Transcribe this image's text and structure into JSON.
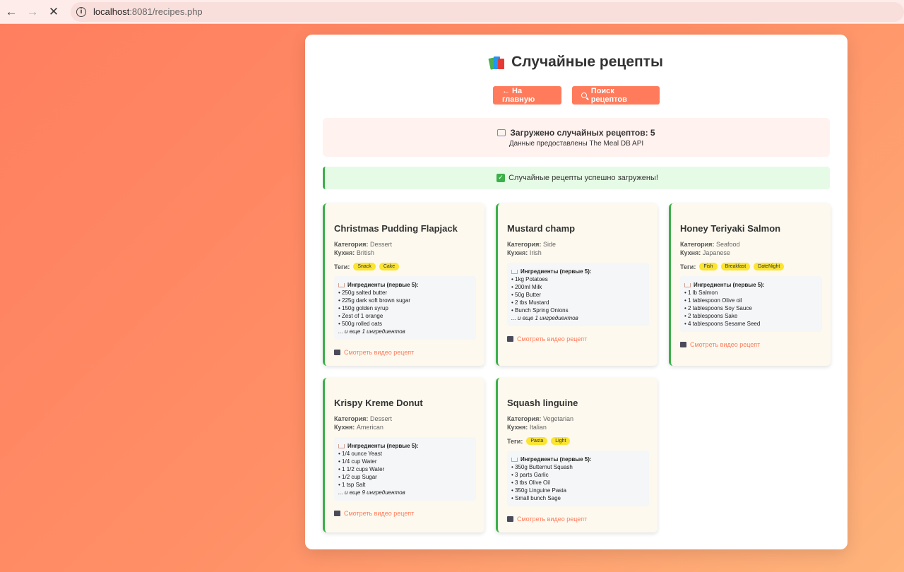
{
  "browser": {
    "url_host": "localhost",
    "url_path": ":8081/recipes.php"
  },
  "page": {
    "title": "Случайные рецепты",
    "home_button": "← На главную",
    "search_button": "Поиск рецептов",
    "info_main": "Загружено случайных рецептов: 5",
    "info_sub": "Данные предоставлены The Meal DB API",
    "success_message": "Случайные рецепты успешно загружены!"
  },
  "labels": {
    "category": "Категория:",
    "cuisine": "Кухня:",
    "tags": "Теги:",
    "ingredients_head": "Ингредиенты (первые 5):",
    "video_link": "Смотреть видео рецепт"
  },
  "recipes": [
    {
      "name": "Christmas Pudding Flapjack",
      "category": "Dessert",
      "cuisine": "British",
      "tags": [
        "Snack",
        "Cake"
      ],
      "ingredients": [
        "250g salted butter",
        "225g dark soft brown sugar",
        "150g golden syrup",
        "Zest of 1 orange",
        "500g rolled oats"
      ],
      "more": "... и еще 1 ингредиентов"
    },
    {
      "name": "Mustard champ",
      "category": "Side",
      "cuisine": "Irish",
      "tags": [],
      "ingredients": [
        "1kg Potatoes",
        "200ml Milk",
        "50g Butter",
        "2 tbs Mustard",
        "Bunch Spring Onions"
      ],
      "more": "... и еще 1 ингредиентов"
    },
    {
      "name": "Honey Teriyaki Salmon",
      "category": "Seafood",
      "cuisine": "Japanese",
      "tags": [
        "Fish",
        "Breakfast",
        "DateNight"
      ],
      "ingredients": [
        "1 lb Salmon",
        "1 tablespoon Olive oil",
        "2 tablespoons Soy Sauce",
        "2 tablespoons Sake",
        "4 tablespoons Sesame Seed"
      ],
      "more": ""
    },
    {
      "name": "Krispy Kreme Donut",
      "category": "Dessert",
      "cuisine": "American",
      "tags": [],
      "ingredients": [
        "1/4 ounce Yeast",
        "1/4 cup Water",
        "1 1/2 cups Water",
        "1/2 cup Sugar",
        "1 tsp Salt"
      ],
      "more": "... и еще 9 ингредиентов"
    },
    {
      "name": "Squash linguine",
      "category": "Vegetarian",
      "cuisine": "Italian",
      "tags": [
        "Pasta",
        "Light"
      ],
      "ingredients": [
        "350g Butternut Squash",
        "3 parts Garlic",
        "3 tbs Olive Oil",
        "350g Linguine Pasta",
        "Small bunch Sage"
      ],
      "more": ""
    }
  ]
}
